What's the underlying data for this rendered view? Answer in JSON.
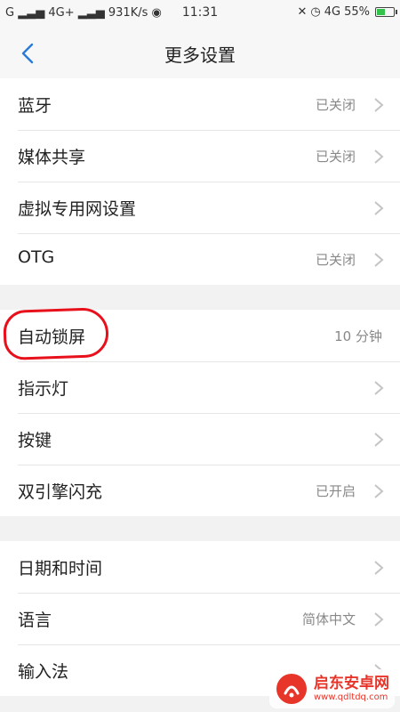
{
  "status_bar": {
    "carrier1": "G",
    "network": "4G+",
    "speed": "931K/s",
    "time": "11:31",
    "network2": "4G",
    "battery_percent": "55%",
    "battery_level": 0.55,
    "battery_color": "#34c34a"
  },
  "header": {
    "title": "更多设置"
  },
  "groups": [
    {
      "items": [
        {
          "label": "蓝牙",
          "value": "已关闭"
        },
        {
          "label": "媒体共享",
          "value": "已关闭"
        },
        {
          "label": "虚拟专用网设置",
          "value": ""
        },
        {
          "label": "OTG",
          "value": "已关闭"
        }
      ]
    },
    {
      "items": [
        {
          "label": "自动锁屏",
          "value": "10 分钟"
        },
        {
          "label": "指示灯",
          "value": ""
        },
        {
          "label": "按键",
          "value": ""
        },
        {
          "label": "双引擎闪充",
          "value": "已开启"
        }
      ]
    },
    {
      "items": [
        {
          "label": "日期和时间",
          "value": ""
        },
        {
          "label": "语言",
          "value": "简体中文"
        },
        {
          "label": "输入法",
          "value": ""
        }
      ]
    }
  ],
  "annotation": {
    "color": "#e8101a"
  },
  "watermark": {
    "name": "启东安卓网",
    "url": "www.qdltdq.com"
  },
  "accent_color": "#2b7bd6"
}
